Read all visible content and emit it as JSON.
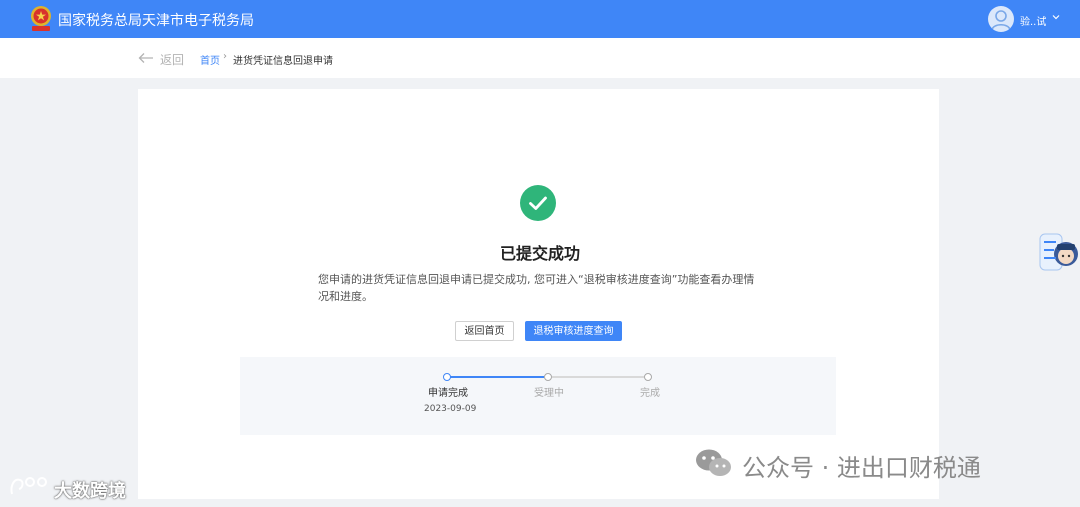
{
  "header": {
    "title": "国家税务总局天津市电子税务局",
    "user_name": "验..试"
  },
  "subnav": {
    "back_label": "返回",
    "breadcrumb": {
      "home": "首页",
      "separator": "›",
      "current": "进货凭证信息回退申请"
    }
  },
  "result": {
    "title": "已提交成功",
    "description": "您申请的进货凭证信息回退申请已提交成功, 您可进入“退税审核进度查询”功能查看办理情况和进度。",
    "buttons": {
      "home": "返回首页",
      "query": "退税审核进度查询"
    }
  },
  "progress": {
    "steps": [
      {
        "label": "申请完成",
        "date": "2023-09-09",
        "status": "done"
      },
      {
        "label": "受理中",
        "status": "pending"
      },
      {
        "label": "完成",
        "status": "pending"
      }
    ]
  },
  "watermarks": {
    "left": "大数跨境",
    "right": "公众号 · 进出口财税通"
  },
  "colors": {
    "primary": "#3f86f7",
    "success": "#2fb57a",
    "header_bg": "#3f86f7",
    "page_bg": "#f0f2f5"
  },
  "icons": {
    "emblem": "national-emblem-icon",
    "avatar": "user-avatar-icon",
    "caret": "chevron-down-icon",
    "back": "arrow-left-icon",
    "success": "check-circle-icon",
    "assistant": "tax-assistant-icon"
  }
}
